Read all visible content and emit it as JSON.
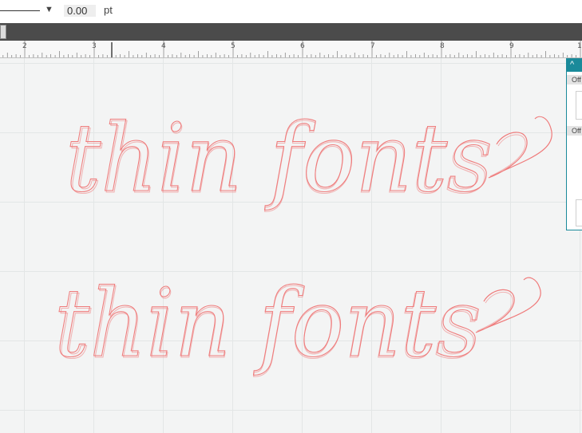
{
  "toolbar": {
    "offset_value": "0.00",
    "unit_label": "pt",
    "dropdown_icon": "triangle-down-icon"
  },
  "ruler": {
    "labels": [
      "2",
      "3",
      "4",
      "5",
      "6",
      "7",
      "8",
      "9",
      "1"
    ]
  },
  "canvas": {
    "text_objects": [
      {
        "text": "thin fonts",
        "color": "#ef7b7b"
      },
      {
        "text": "thin fonts",
        "color": "#ef7b7b"
      }
    ]
  },
  "panel": {
    "collapse_icon": "chevron-up-icon",
    "sections": [
      {
        "label": "Off"
      },
      {
        "label": "Off"
      }
    ]
  }
}
